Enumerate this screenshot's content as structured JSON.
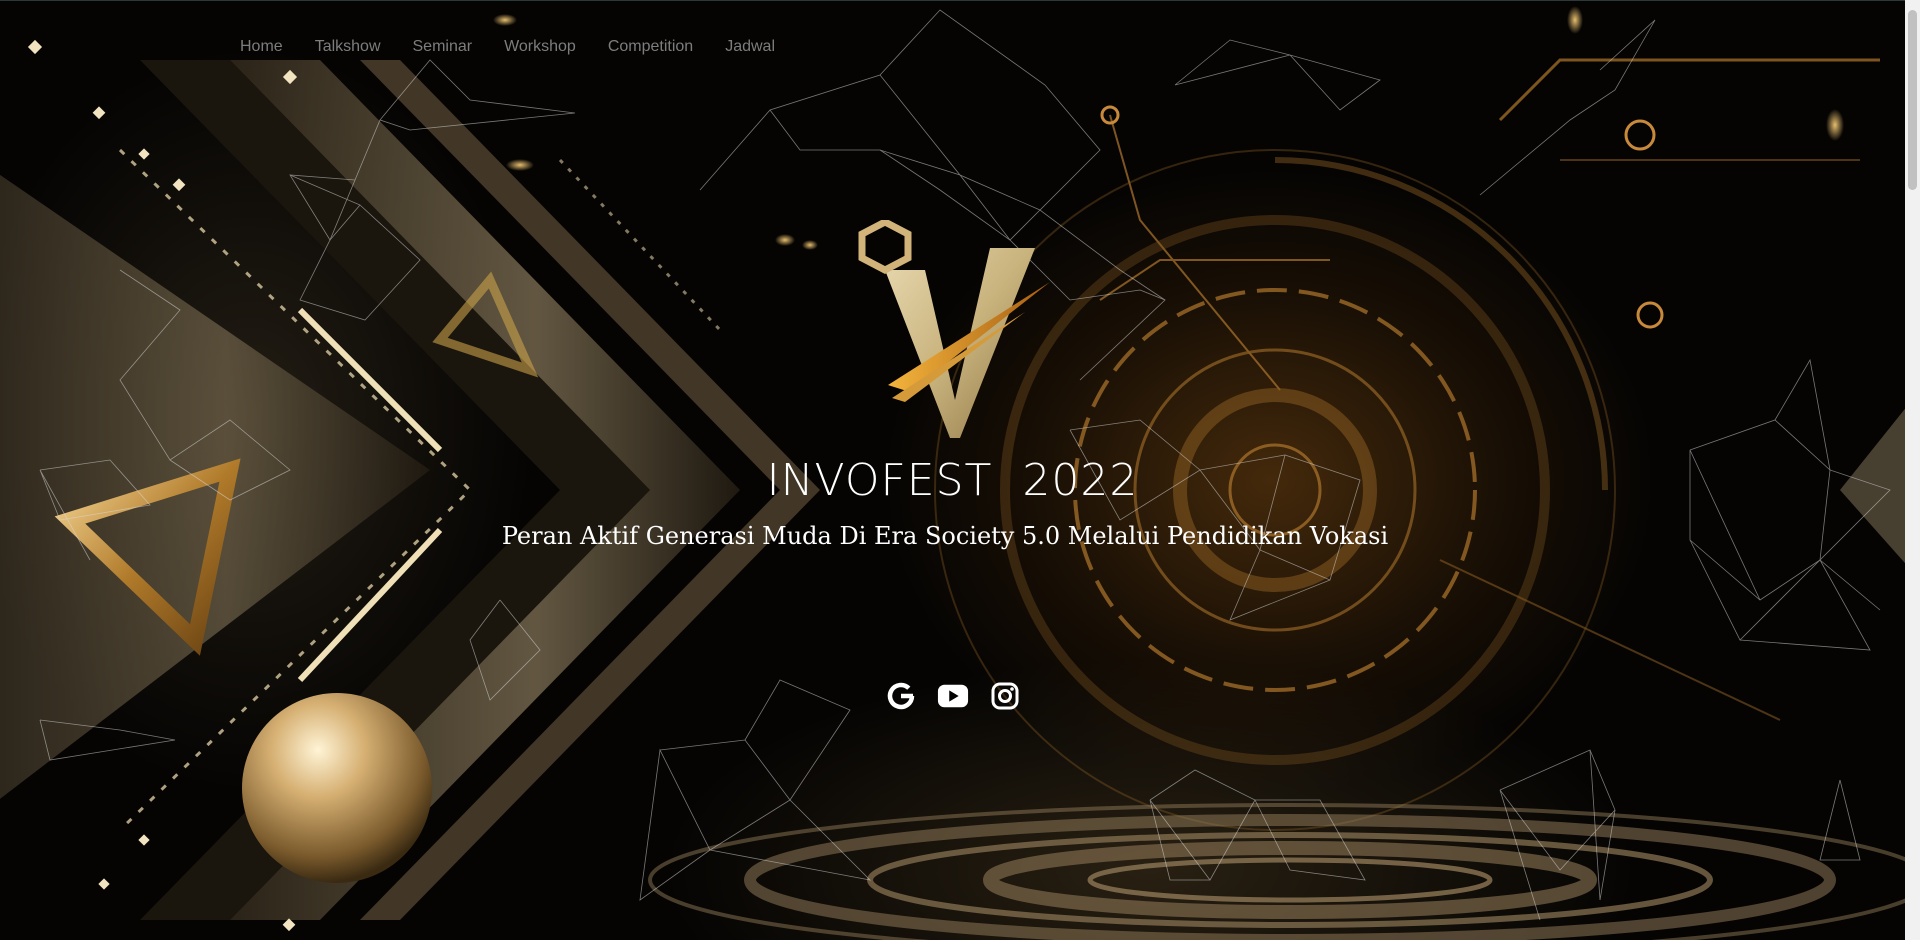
{
  "nav": {
    "items": [
      {
        "label": "Home"
      },
      {
        "label": "Talkshow"
      },
      {
        "label": "Seminar"
      },
      {
        "label": "Workshop"
      },
      {
        "label": "Competition"
      },
      {
        "label": "Jadwal"
      }
    ]
  },
  "hero": {
    "title": "INVOFEST  2022",
    "tagline": "Peran Aktif Generasi Muda Di Era Society 5.0 Melalui Pendidikan Vokasi",
    "logo_icon": "invofest-v-logo"
  },
  "socials": [
    {
      "icon": "google-icon"
    },
    {
      "icon": "youtube-icon"
    },
    {
      "icon": "instagram-icon"
    }
  ],
  "colors": {
    "background": "#050403",
    "gold": "#c9a24a",
    "nav_text": "#7d7d7d",
    "hero_text": "#ffffff"
  }
}
